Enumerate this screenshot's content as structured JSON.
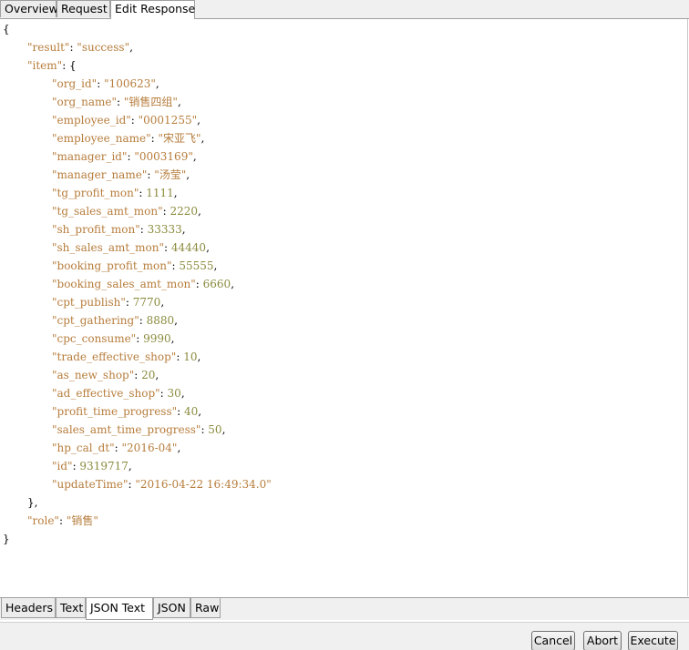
{
  "top_tabs": [
    "Overview",
    "Request",
    "Edit Response"
  ],
  "active_top_tab": "Edit Response",
  "json_lines": [
    [
      [
        "p",
        "{"
      ]
    ],
    [
      [
        "k",
        "\"result\""
      ],
      [
        "p",
        ": "
      ],
      [
        "s",
        "\"success\""
      ],
      [
        "p",
        ","
      ]
    ],
    [
      [
        "k",
        "\"item\""
      ],
      [
        "p",
        ": {"
      ]
    ],
    [
      [
        "k",
        "\"org_id\""
      ],
      [
        "p",
        ": "
      ],
      [
        "s",
        "\"100623\""
      ],
      [
        "p",
        ","
      ]
    ],
    [
      [
        "k",
        "\"org_name\""
      ],
      [
        "p",
        ": "
      ],
      [
        "s",
        "\"销售四组\""
      ],
      [
        "p",
        ","
      ]
    ],
    [
      [
        "k",
        "\"employee_id\""
      ],
      [
        "p",
        ": "
      ],
      [
        "s",
        "\"0001255\""
      ],
      [
        "p",
        ","
      ]
    ],
    [
      [
        "k",
        "\"employee_name\""
      ],
      [
        "p",
        ": "
      ],
      [
        "s",
        "\"宋亚飞\""
      ],
      [
        "p",
        ","
      ]
    ],
    [
      [
        "k",
        "\"manager_id\""
      ],
      [
        "p",
        ": "
      ],
      [
        "s",
        "\"0003169\""
      ],
      [
        "p",
        ","
      ]
    ],
    [
      [
        "k",
        "\"manager_name\""
      ],
      [
        "p",
        ": "
      ],
      [
        "s",
        "\"汤莹\""
      ],
      [
        "p",
        ","
      ]
    ],
    [
      [
        "k",
        "\"tg_profit_mon\""
      ],
      [
        "p",
        ": "
      ],
      [
        "n",
        "1111"
      ],
      [
        "p",
        ","
      ]
    ],
    [
      [
        "k",
        "\"tg_sales_amt_mon\""
      ],
      [
        "p",
        ": "
      ],
      [
        "n",
        "2220"
      ],
      [
        "p",
        ","
      ]
    ],
    [
      [
        "k",
        "\"sh_profit_mon\""
      ],
      [
        "p",
        ": "
      ],
      [
        "n",
        "33333"
      ],
      [
        "p",
        ","
      ]
    ],
    [
      [
        "k",
        "\"sh_sales_amt_mon\""
      ],
      [
        "p",
        ": "
      ],
      [
        "n",
        "44440"
      ],
      [
        "p",
        ","
      ]
    ],
    [
      [
        "k",
        "\"booking_profit_mon\""
      ],
      [
        "p",
        ": "
      ],
      [
        "n",
        "55555"
      ],
      [
        "p",
        ","
      ]
    ],
    [
      [
        "k",
        "\"booking_sales_amt_mon\""
      ],
      [
        "p",
        ": "
      ],
      [
        "n",
        "6660"
      ],
      [
        "p",
        ","
      ]
    ],
    [
      [
        "k",
        "\"cpt_publish\""
      ],
      [
        "p",
        ": "
      ],
      [
        "n",
        "7770"
      ],
      [
        "p",
        ","
      ]
    ],
    [
      [
        "k",
        "\"cpt_gathering\""
      ],
      [
        "p",
        ": "
      ],
      [
        "n",
        "8880"
      ],
      [
        "p",
        ","
      ]
    ],
    [
      [
        "k",
        "\"cpc_consume\""
      ],
      [
        "p",
        ": "
      ],
      [
        "n",
        "9990"
      ],
      [
        "p",
        ","
      ]
    ],
    [
      [
        "k",
        "\"trade_effective_shop\""
      ],
      [
        "p",
        ": "
      ],
      [
        "n",
        "10"
      ],
      [
        "p",
        ","
      ]
    ],
    [
      [
        "k",
        "\"as_new_shop\""
      ],
      [
        "p",
        ": "
      ],
      [
        "n",
        "20"
      ],
      [
        "p",
        ","
      ]
    ],
    [
      [
        "k",
        "\"ad_effective_shop\""
      ],
      [
        "p",
        ": "
      ],
      [
        "n",
        "30"
      ],
      [
        "p",
        ","
      ]
    ],
    [
      [
        "k",
        "\"profit_time_progress\""
      ],
      [
        "p",
        ": "
      ],
      [
        "n",
        "40"
      ],
      [
        "p",
        ","
      ]
    ],
    [
      [
        "k",
        "\"sales_amt_time_progress\""
      ],
      [
        "p",
        ": "
      ],
      [
        "n",
        "50"
      ],
      [
        "p",
        ","
      ]
    ],
    [
      [
        "k",
        "\"hp_cal_dt\""
      ],
      [
        "p",
        ": "
      ],
      [
        "s",
        "\"2016-04\""
      ],
      [
        "p",
        ","
      ]
    ],
    [
      [
        "k",
        "\"id\""
      ],
      [
        "p",
        ": "
      ],
      [
        "n",
        "9319717"
      ],
      [
        "p",
        ","
      ]
    ],
    [
      [
        "k",
        "\"updateTime\""
      ],
      [
        "p",
        ": "
      ],
      [
        "s",
        "\"2016-04-22 16:49:34.0\""
      ]
    ],
    [
      [
        "p",
        "},"
      ]
    ],
    [
      [
        "k",
        "\"role\""
      ],
      [
        "p",
        ": "
      ],
      [
        "s",
        "\"销售\""
      ]
    ],
    [
      [
        "p",
        "}"
      ]
    ]
  ],
  "bottom_tabs": [
    "Headers",
    "Text",
    "JSON Text",
    "JSON",
    "Raw"
  ],
  "active_bottom_tab": "JSON Text",
  "buttons": {
    "cancel": "Cancel",
    "abort": "Abort",
    "execute": "Execute"
  },
  "colors": {
    "key": "#b77d3c",
    "string": "#b77d3c",
    "number": "#8b8b3f"
  }
}
